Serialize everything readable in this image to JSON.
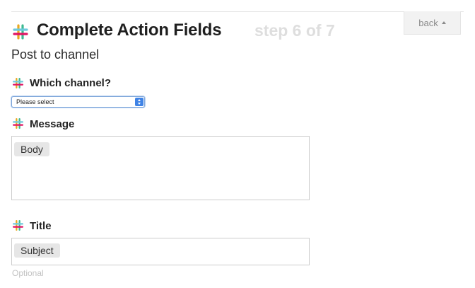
{
  "header": {
    "title": "Complete Action Fields",
    "step": "step 6 of 7",
    "back_label": "back",
    "app_icon": "slack-icon"
  },
  "action": {
    "subtitle": "Post to channel"
  },
  "fields": {
    "channel": {
      "label": "Which channel?",
      "selected": "Please select",
      "icon": "slack-icon"
    },
    "message": {
      "label": "Message",
      "token": "Body",
      "icon": "slack-icon"
    },
    "title": {
      "label": "Title",
      "token": "Subject",
      "hint": "Optional",
      "icon": "slack-icon"
    }
  },
  "colors": {
    "slack_teal": "#6ecadc",
    "slack_yellow": "#e9a820",
    "slack_red": "#e01563",
    "slack_green": "#3eb991",
    "select_accent": "#3f83e6",
    "step_text": "#dedede"
  }
}
